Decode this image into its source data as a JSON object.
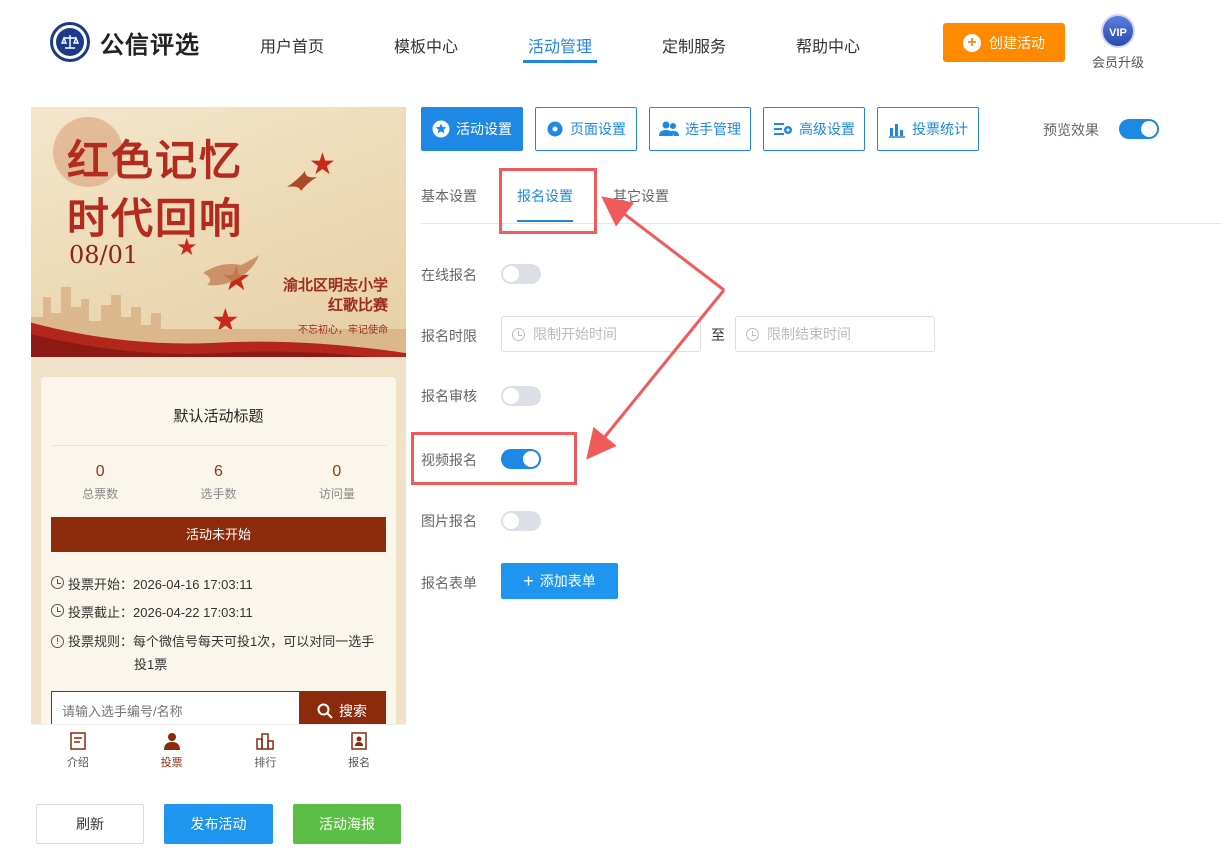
{
  "header": {
    "brand": "公信评选",
    "nav": [
      {
        "label": "用户首页",
        "active": false
      },
      {
        "label": "模板中心",
        "active": false
      },
      {
        "label": "活动管理",
        "active": true
      },
      {
        "label": "定制服务",
        "active": false
      },
      {
        "label": "帮助中心",
        "active": false
      }
    ],
    "create_label": "创建活动",
    "vip_badge": "VIP",
    "vip_label": "会员升级"
  },
  "poster": {
    "title_line1": "红色记忆",
    "title_line2": "时代回响",
    "date": "08/01",
    "school_line1": "渝北区明志小学",
    "school_line2": "红歌比赛",
    "slogan": "不忘初心，牢记使命"
  },
  "card": {
    "title": "默认活动标题",
    "stats": [
      {
        "value": "0",
        "label": "总票数"
      },
      {
        "value": "6",
        "label": "选手数"
      },
      {
        "value": "0",
        "label": "访问量"
      }
    ],
    "status": "活动未开始",
    "vote_start": "投票开始：2026-04-16 17:03:11",
    "vote_end": "投票截止：2026-04-22 17:03:11",
    "rule_line1": "投票规则：每个微信号每天可投1次，可以对同一选手",
    "rule_line2": "投1票",
    "search_placeholder": "请输入选手编号/名称",
    "search_label": "搜索"
  },
  "tabbar": [
    {
      "label": "介绍",
      "icon": "intro-icon"
    },
    {
      "label": "投票",
      "icon": "person-icon",
      "active": true
    },
    {
      "label": "排行",
      "icon": "ranking-icon"
    },
    {
      "label": "报名",
      "icon": "signup-icon"
    }
  ],
  "bottom_buttons": {
    "refresh": "刷新",
    "publish": "发布活动",
    "poster": "活动海报"
  },
  "toolbar": [
    {
      "label": "活动设置",
      "icon": "star-icon",
      "active": true
    },
    {
      "label": "页面设置",
      "icon": "gear-icon",
      "active": false
    },
    {
      "label": "选手管理",
      "icon": "users-icon",
      "active": false
    },
    {
      "label": "高级设置",
      "icon": "advanced-settings-icon",
      "active": false
    },
    {
      "label": "投票统计",
      "icon": "bar-chart-icon",
      "active": false
    }
  ],
  "preview_label": "预览效果",
  "preview_on": true,
  "subtabs": [
    {
      "label": "基本设置",
      "active": false
    },
    {
      "label": "报名设置",
      "active": true
    },
    {
      "label": "其它设置",
      "active": false
    }
  ],
  "form": {
    "online_signup": {
      "label": "在线报名",
      "on": false
    },
    "signup_period": {
      "label": "报名时限",
      "start_placeholder": "限制开始时间",
      "to": "至",
      "end_placeholder": "限制结束时间"
    },
    "signup_review": {
      "label": "报名审核",
      "on": false
    },
    "video_signup": {
      "label": "视频报名",
      "on": true
    },
    "image_signup": {
      "label": "图片报名",
      "on": false
    },
    "signup_form": {
      "label": "报名表单",
      "add_label": "添加表单"
    }
  },
  "colors": {
    "accent": "#1e88e5",
    "orange": "#ff8a00",
    "poster_red": "#8c2b0c",
    "annotation": "#f05a5a"
  }
}
